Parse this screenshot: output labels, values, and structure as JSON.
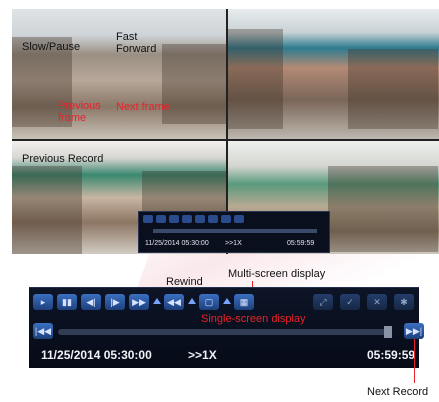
{
  "grid": {
    "cam1": {
      "annotations": {
        "slow_pause": "Slow/Pause",
        "fast_forward_1": "Fast",
        "fast_forward_2": "Forward",
        "previous_frame_1": "Previous",
        "previous_frame_2": "frame",
        "next_frame": "Next frame"
      }
    },
    "cam3": {
      "previous_record": "Previous Record"
    },
    "mini_toolbar": {
      "datetime": "11/25/2014 05:30:00",
      "speed": ">>1X",
      "time_left": "05:59:59"
    }
  },
  "labels": {
    "rewind": "Rewind",
    "multi_screen": "Multi-screen display",
    "single_screen": "Single-screen display",
    "next_record": "Next Record"
  },
  "toolbar": {
    "datetime": "11/25/2014 05:30:00",
    "speed": ">>1X",
    "time_left": "05:59:59",
    "progress": 0.98
  },
  "colors": {
    "annotation_red": "#e8232a",
    "toolbar_bg": "#0c1426",
    "button_blue": "#2a5aa8"
  }
}
